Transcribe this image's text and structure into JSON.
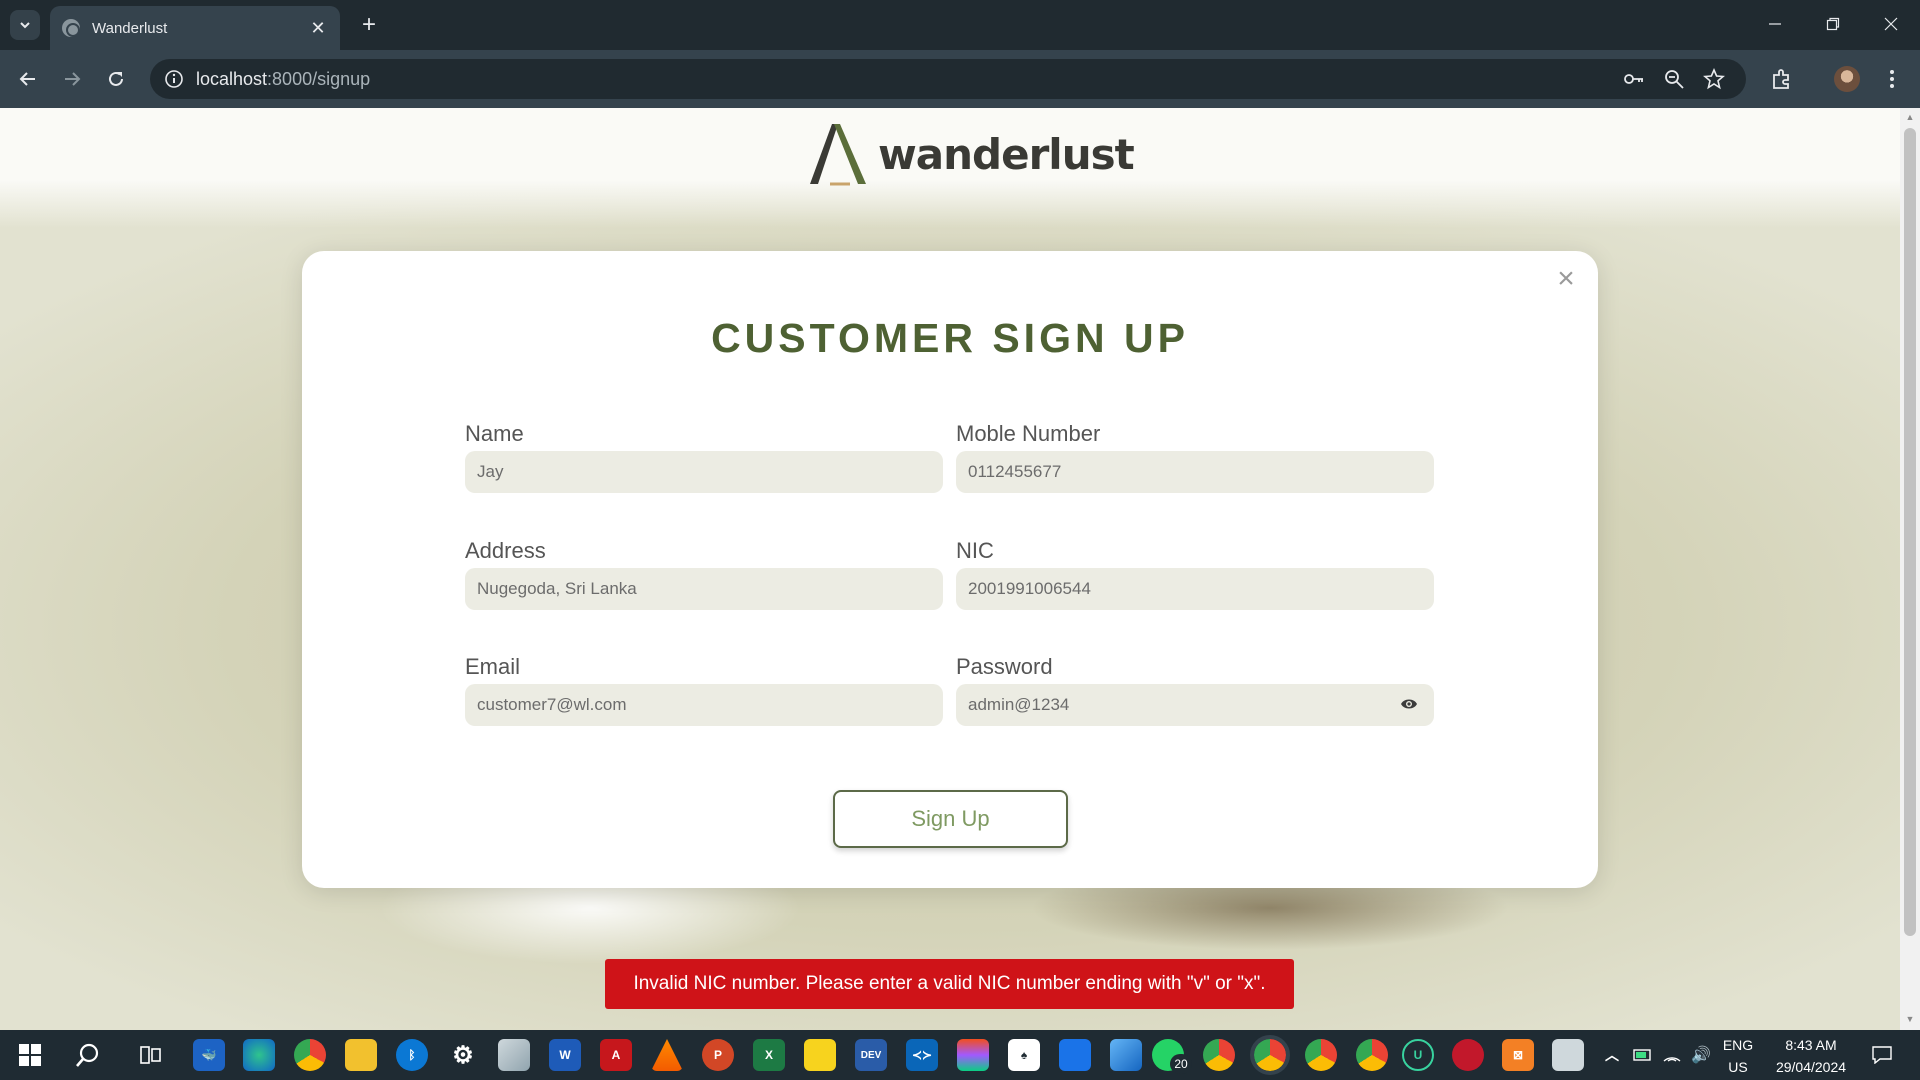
{
  "browser": {
    "tab_title": "Wanderlust",
    "url_host": "localhost",
    "url_path": ":8000/signup"
  },
  "logo": {
    "text": "wanderlust"
  },
  "signup": {
    "title": "CUSTOMER SIGN UP",
    "close_glyph": "×",
    "fields": {
      "name": {
        "label": "Name",
        "value": "Jay"
      },
      "mobile": {
        "label": "Moble Number",
        "value": "0112455677"
      },
      "address": {
        "label": "Address",
        "value": "Nugegoda, Sri Lanka"
      },
      "nic": {
        "label": "NIC",
        "value": "2001991006544"
      },
      "email": {
        "label": "Email",
        "value": "customer7@wl.com"
      },
      "password": {
        "label": "Password",
        "value": "admin@1234"
      }
    },
    "submit_label": "Sign Up"
  },
  "toast": {
    "message": "Invalid NIC number. Please enter a valid NIC number ending with \"v\" or \"x\"."
  },
  "taskbar": {
    "whatsapp_badge": "20",
    "language": "ENG",
    "region": "US",
    "time": "8:43 AM",
    "date": "29/04/2024"
  },
  "colors": {
    "brand_green": "#4e6133",
    "error_red": "#cf1318",
    "field_bg": "#ecece3"
  }
}
